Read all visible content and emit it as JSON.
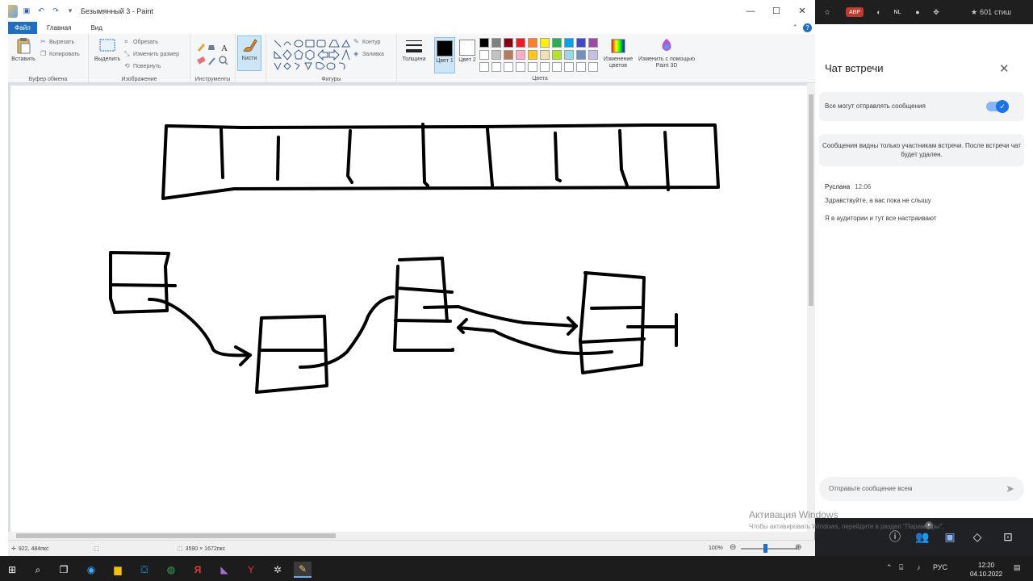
{
  "window": {
    "title": "Безымянный 3 - Paint"
  },
  "menu": {
    "file": "Файл",
    "home": "Главная",
    "view": "Вид"
  },
  "ribbon": {
    "clipboard": {
      "label": "Буфер обмена",
      "paste": "Вставить",
      "cut": "Вырезать",
      "copy": "Копировать"
    },
    "image": {
      "label": "Изображение",
      "select": "Выделить",
      "crop": "Обрезать",
      "resize": "Изменить размер",
      "rotate": "Повернуть"
    },
    "tools": {
      "label": "Инструменты"
    },
    "brushes": {
      "label": "Кисти"
    },
    "shapes": {
      "label": "Фигуры",
      "outline": "Контур",
      "fill": "Заливка"
    },
    "thickness": "Толщина",
    "color1": "Цвет 1",
    "color2": "Цвет 2",
    "colors": {
      "label": "Цвета",
      "palette": [
        "#000000",
        "#7f7f7f",
        "#880015",
        "#ed1c24",
        "#ff7f27",
        "#fff200",
        "#22b14c",
        "#00a2e8",
        "#3f48cc",
        "#a349a4",
        "#ffffff",
        "#c3c3c3",
        "#b97a57",
        "#ffaec9",
        "#ffc90e",
        "#efe4b0",
        "#b5e61d",
        "#99d9ea",
        "#7092be",
        "#c8bfe7",
        "#ffffff",
        "#ffffff",
        "#ffffff",
        "#ffffff",
        "#ffffff",
        "#ffffff",
        "#ffffff",
        "#ffffff",
        "#ffffff",
        "#ffffff"
      ]
    },
    "edit_colors": "Изменение цветов",
    "paint3d": "Изменить с помощью Paint 3D"
  },
  "status": {
    "cursor": "922, 484пкс",
    "canvas_size": "3590 × 1672пкс",
    "zoom": "100%"
  },
  "chat": {
    "title": "Чат встречи",
    "allow_label": "Все могут отправлять сообщения",
    "info": "Сообщения видны только участникам встречи. После встречи чат будет удален.",
    "sender": "Руслана",
    "time": "12:06",
    "messages": [
      "Здравствуйте, а вас пока не слышу",
      "Я в аудитории и тут все настраивают"
    ],
    "input_placeholder": "Отправьте сообщение всем",
    "topbar_count": "601",
    "topbar_label": "стиш"
  },
  "watermark": {
    "title": "Активация Windows",
    "subtitle": "Чтобы активировать Windows, перейдите в раздел \"Параметры\"."
  },
  "taskbar": {
    "lang": "РУС",
    "time": "12:20",
    "date": "04.10.2022"
  }
}
